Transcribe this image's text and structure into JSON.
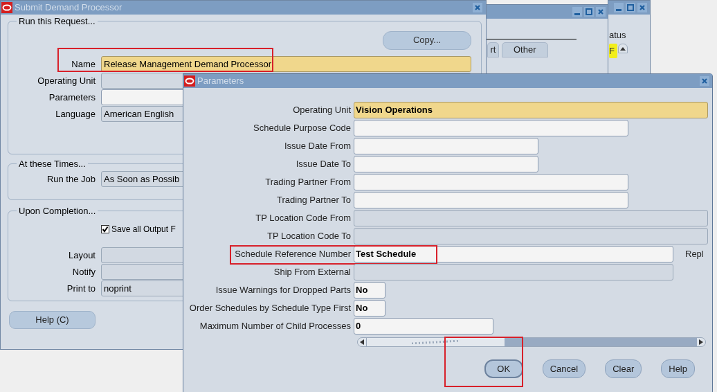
{
  "back_windows": [
    {
      "kind": "tabs",
      "tabs": [
        {
          "label": "rt",
          "selected": false
        },
        {
          "label": "Other",
          "selected": false
        }
      ]
    },
    {
      "kind": "status",
      "column_header": "atus",
      "cell": "F"
    }
  ],
  "submit_window": {
    "title": "Submit Demand Processor",
    "copy_button": "Copy...",
    "request_group": {
      "legend": "Run this Request...",
      "fields": [
        {
          "label": "Name",
          "value": "Release Management Demand Processor",
          "required": true,
          "highlighted": true
        },
        {
          "label": "Operating Unit",
          "disabled": true
        },
        {
          "label": "Parameters",
          "disabled": false
        },
        {
          "label": "Language",
          "value": "American English",
          "disabled": true
        }
      ]
    },
    "times_group": {
      "legend": "At these Times...",
      "fields": [
        {
          "label": "Run the Job",
          "value": "As Soon as Possib",
          "disabled": true
        }
      ]
    },
    "completion_group": {
      "legend": "Upon Completion...",
      "checkbox": {
        "label": "Save all Output F",
        "checked": true
      },
      "fields": [
        {
          "label": "Layout",
          "disabled": true
        },
        {
          "label": "Notify",
          "disabled": true
        },
        {
          "label": "Print to",
          "value": "noprint",
          "disabled": true
        }
      ]
    },
    "help_button": "Help (C)"
  },
  "parameters_dialog": {
    "title": "Parameters",
    "fields": [
      {
        "label": "Operating Unit",
        "value": "Vision Operations",
        "kind": "full",
        "required": true,
        "disabled": false,
        "highlighted": false
      },
      {
        "label": "Schedule Purpose Code",
        "kind": "long",
        "disabled": false,
        "highlighted": false
      },
      {
        "label": "Issue Date From",
        "kind": "medium",
        "disabled": false,
        "highlighted": false
      },
      {
        "label": "Issue Date To",
        "kind": "medium",
        "disabled": false,
        "highlighted": false
      },
      {
        "label": "Trading Partner From",
        "kind": "long",
        "disabled": false,
        "highlighted": false
      },
      {
        "label": "Trading Partner To",
        "kind": "long",
        "disabled": false,
        "highlighted": false
      },
      {
        "label": "TP Location Code From",
        "kind": "full",
        "disabled": true,
        "highlighted": false
      },
      {
        "label": "TP Location Code To",
        "kind": "full",
        "disabled": true,
        "highlighted": false
      },
      {
        "label": "Schedule Reference Number",
        "value": "Test Schedule",
        "kind": "xlong",
        "disabled": false,
        "highlighted": true,
        "suffix": "Repl"
      },
      {
        "label": "Ship From External",
        "kind": "xlong",
        "disabled": true,
        "highlighted": false
      },
      {
        "label": "Issue Warnings for Dropped Parts",
        "value": "No",
        "kind": "short",
        "disabled": false,
        "highlighted": false
      },
      {
        "label": "Order Schedules by Schedule Type First",
        "value": "No",
        "kind": "short",
        "disabled": false,
        "highlighted": false
      },
      {
        "label": "Maximum Number of Child Processes",
        "value": "0",
        "kind": "number",
        "disabled": false,
        "highlighted": false
      }
    ],
    "buttons": [
      {
        "label": "OK",
        "default": true,
        "highlighted": true
      },
      {
        "label": "Cancel",
        "default": false,
        "highlighted": false
      },
      {
        "label": "Clear",
        "default": false,
        "highlighted": false
      },
      {
        "label": "Help",
        "default": false,
        "highlighted": false
      }
    ]
  }
}
